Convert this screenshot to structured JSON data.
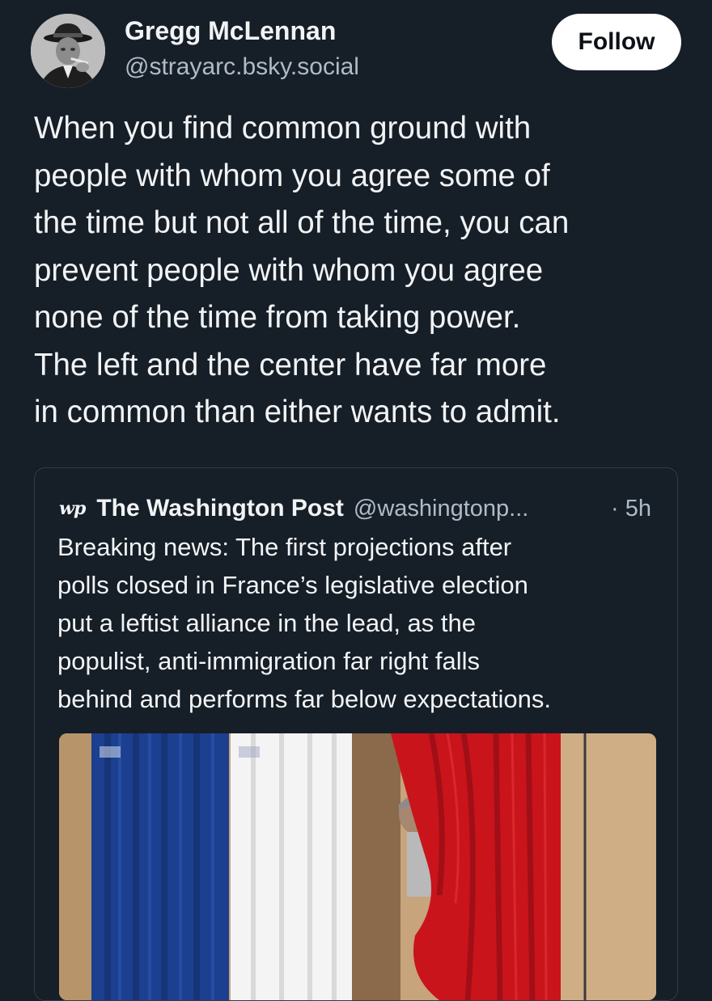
{
  "post": {
    "author_name": "Gregg McLennan",
    "author_handle": "@strayarc.bsky.social",
    "follow_label": "Follow",
    "text": "When you find common ground with\npeople with whom you agree some of\nthe time but not all of the time, you can\nprevent people with whom you agree\nnone of the time from taking power.\nThe left and the center have far more\nin common than either wants to admit."
  },
  "quote": {
    "logo_text": "wp",
    "author_name": "The Washington Post",
    "author_handle": "@washingtonp...",
    "time": "· 5h",
    "text": "Breaking news: The first projections after\npolls closed in France’s legislative election\nput a leftist alliance in the lead, as the\npopulist, anti-immigration far right falls\nbehind and performs far below expectations."
  },
  "icons": {
    "avatar": "avatar-photo",
    "logo": "washington-post-logo-icon"
  },
  "colors": {
    "background": "#161e27",
    "text": "#f1f3f5",
    "secondary_text": "#aebbc9",
    "border": "#2f3c4b",
    "follow_bg": "#ffffff"
  }
}
